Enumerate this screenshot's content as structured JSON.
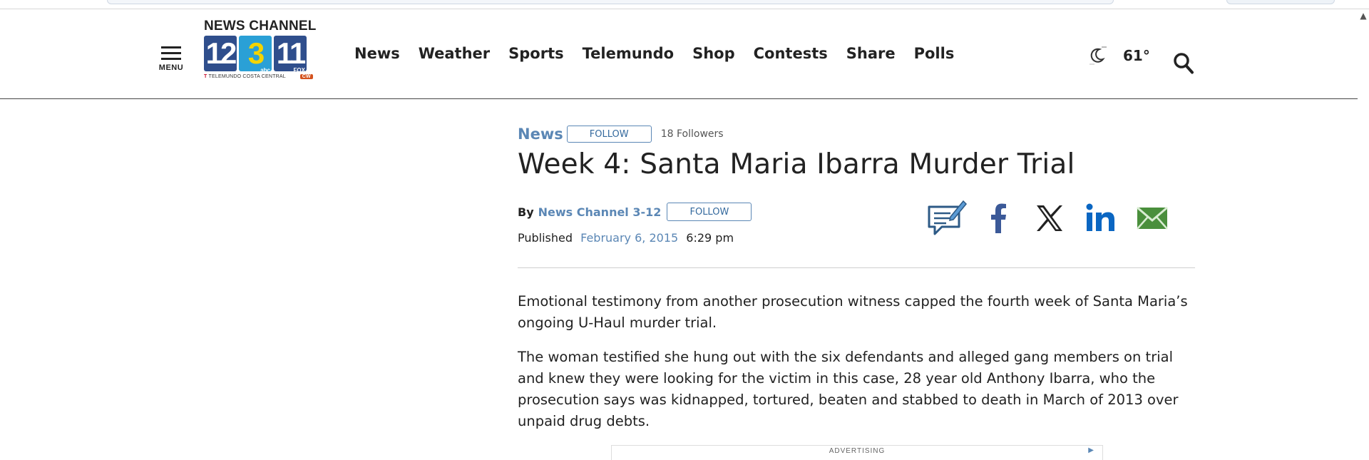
{
  "browser": {
    "scroll_up_glyph": "▲"
  },
  "header": {
    "menu_label": "MENU",
    "logo": {
      "title": "NEWS CHANNEL",
      "tiles": [
        "12",
        "3",
        "11"
      ],
      "tile_tags": [
        "",
        "abc",
        "FOX"
      ],
      "sub_brand": "TELEMUNDO COSTA CENTRAL",
      "sub_badge": "CW"
    },
    "nav": [
      "News",
      "Weather",
      "Sports",
      "Telemundo",
      "Shop",
      "Contests",
      "Share",
      "Polls"
    ],
    "weather": {
      "icon": "moon-icon",
      "temperature": "61°"
    }
  },
  "article": {
    "category": "News",
    "category_follow_label": "FOLLOW",
    "followers": "18 Followers",
    "headline": "Week 4: Santa Maria Ibarra Murder Trial",
    "by_label": "By",
    "author": "News Channel 3-12",
    "author_follow_label": "FOLLOW",
    "published_label": "Published",
    "published_date": "February 6, 2015",
    "published_time": "6:29 pm",
    "share_icons": [
      "comment-icon",
      "facebook-icon",
      "x-icon",
      "linkedin-icon",
      "email-icon"
    ],
    "paragraphs": [
      "Emotional testimony from another prosecution witness capped the fourth week of Santa Maria’s ongoing U-Haul murder trial.",
      "The woman testified she hung out with the six defendants and alleged gang members on trial and knew they were looking for the victim in this case, 28 year old Anthony Ibarra, who the prosecution says was kidnapped, tortured, beaten and stabbed to death in March of 2013 over unpaid drug debts."
    ],
    "advertisement_label": "ADVERTISING"
  },
  "colors": {
    "link_blue": "#5b87b5",
    "text": "#222222",
    "facebook": "#3b5998",
    "linkedin": "#0a66c2",
    "email_green": "#4a8f3c"
  }
}
